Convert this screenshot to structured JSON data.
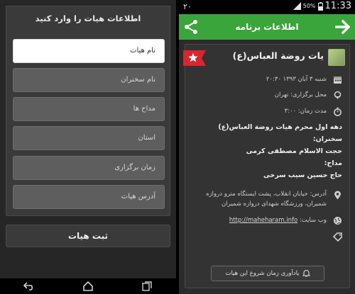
{
  "left": {
    "card_title": "اطلاعات هیات را وارد کنید",
    "fields": [
      {
        "placeholder": "نام هیات"
      },
      {
        "placeholder": "نام سخنران"
      },
      {
        "placeholder": "مداح ها"
      },
      {
        "placeholder": "استان"
      },
      {
        "placeholder": "زمان برگزاری"
      },
      {
        "placeholder": "آدرس هیات"
      }
    ],
    "submit_label": "ثبت هیات"
  },
  "status": {
    "left_text": "۲۰",
    "battery": "50%",
    "time": "11:33"
  },
  "app_bar": {
    "title": "اطلاعات برنامه"
  },
  "event": {
    "title": "یات روضة العباس(ع)",
    "date": "شنبه ۳ آبان ۱۳۹۳ ۲۰:۳۰",
    "location": "محل برگزاری: تهران",
    "duration": "مدت زمان: ۳:۰۰",
    "desc_line1": "دهه اول محرم هیات روضة العباس(ع)",
    "desc_line2": "سخنران:",
    "desc_line3": "حجت الاسلام مصطفی کرمی",
    "desc_line4": "مداح:",
    "desc_line5": "حاج حسین سیب سرخی",
    "address": "آدرس: خیابان انقلاب، پشت ایستگاه مترو دروازه شمیران، ورزشگاه شهدای دروازه شمیران",
    "website_label": "وب سایت:",
    "website": "http://maheharam.info",
    "reminder": "یادآوری زمان شروع این هیات"
  },
  "colors": {
    "accent_green": "#3aa53b",
    "ribbon_red": "#d8262e"
  }
}
